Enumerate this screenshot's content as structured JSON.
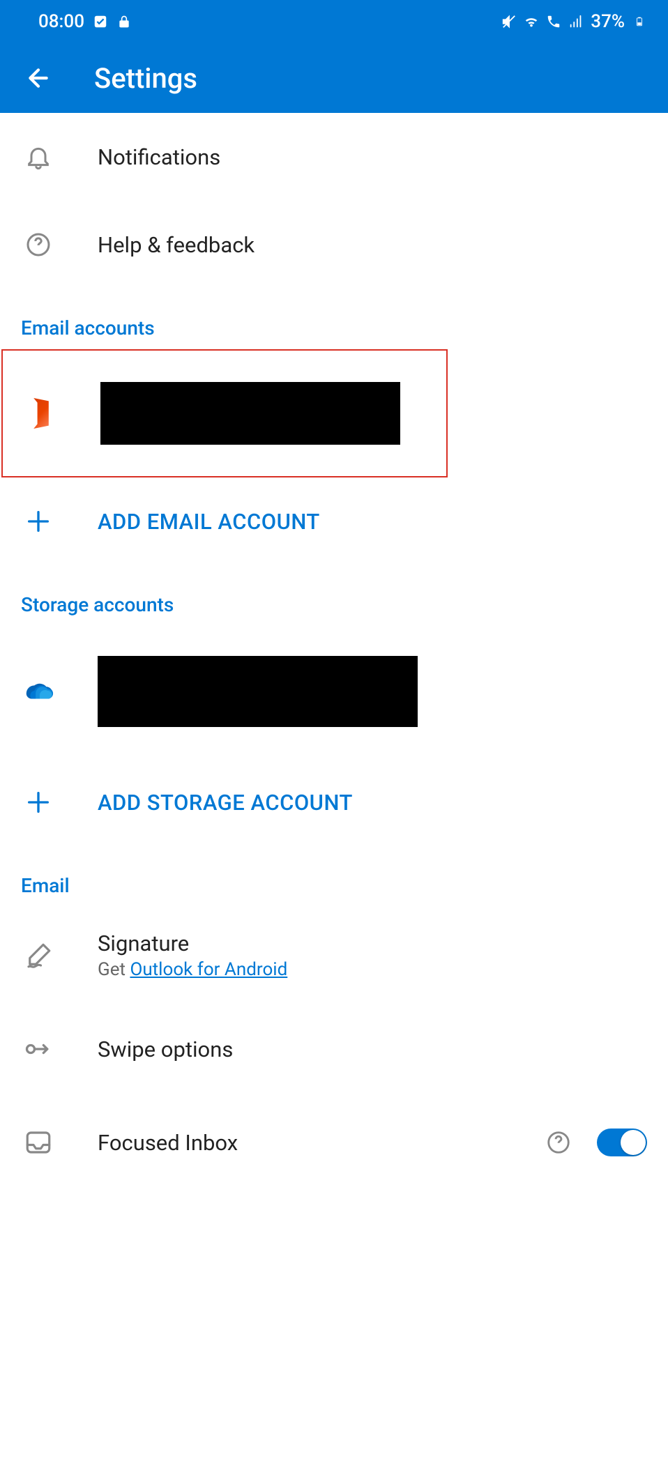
{
  "statusBar": {
    "time": "08:00",
    "battery": "37%"
  },
  "header": {
    "title": "Settings"
  },
  "rows": {
    "notifications": "Notifications",
    "help": "Help & feedback",
    "addEmail": "ADD EMAIL ACCOUNT",
    "addStorage": "ADD STORAGE ACCOUNT",
    "signature": {
      "title": "Signature",
      "subPrefix": "Get ",
      "subLink": "Outlook for Android"
    },
    "swipe": "Swipe options",
    "focused": "Focused Inbox"
  },
  "sections": {
    "emailAccounts": "Email accounts",
    "storageAccounts": "Storage accounts",
    "email": "Email"
  }
}
